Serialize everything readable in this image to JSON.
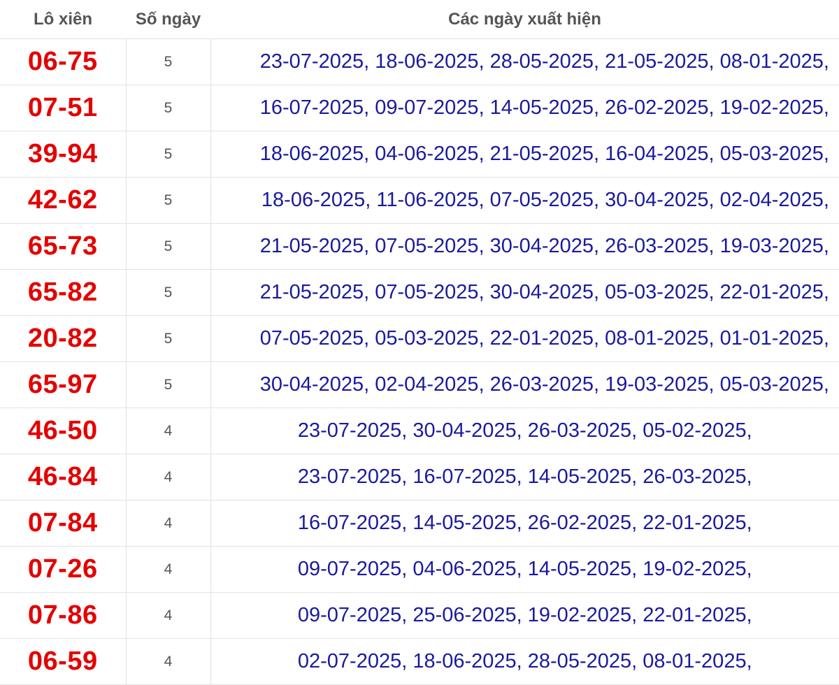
{
  "table": {
    "headers": {
      "pair": "Lô xiên",
      "count": "Số ngày",
      "dates": "Các ngày xuất hiện"
    },
    "rows": [
      {
        "pair": "06-75",
        "count": "5",
        "dates": "23-07-2025, 18-06-2025, 28-05-2025, 21-05-2025, 08-01-2025,"
      },
      {
        "pair": "07-51",
        "count": "5",
        "dates": "16-07-2025, 09-07-2025, 14-05-2025, 26-02-2025, 19-02-2025,"
      },
      {
        "pair": "39-94",
        "count": "5",
        "dates": "18-06-2025, 04-06-2025, 21-05-2025, 16-04-2025, 05-03-2025,"
      },
      {
        "pair": "42-62",
        "count": "5",
        "dates": "18-06-2025, 11-06-2025, 07-05-2025, 30-04-2025, 02-04-2025,"
      },
      {
        "pair": "65-73",
        "count": "5",
        "dates": "21-05-2025, 07-05-2025, 30-04-2025, 26-03-2025, 19-03-2025,"
      },
      {
        "pair": "65-82",
        "count": "5",
        "dates": "21-05-2025, 07-05-2025, 30-04-2025, 05-03-2025, 22-01-2025,"
      },
      {
        "pair": "20-82",
        "count": "5",
        "dates": "07-05-2025, 05-03-2025, 22-01-2025, 08-01-2025, 01-01-2025,"
      },
      {
        "pair": "65-97",
        "count": "5",
        "dates": "30-04-2025, 02-04-2025, 26-03-2025, 19-03-2025, 05-03-2025,"
      },
      {
        "pair": "46-50",
        "count": "4",
        "dates": "23-07-2025, 30-04-2025, 26-03-2025, 05-02-2025,"
      },
      {
        "pair": "46-84",
        "count": "4",
        "dates": "23-07-2025, 16-07-2025, 14-05-2025, 26-03-2025,"
      },
      {
        "pair": "07-84",
        "count": "4",
        "dates": "16-07-2025, 14-05-2025, 26-02-2025, 22-01-2025,"
      },
      {
        "pair": "07-26",
        "count": "4",
        "dates": "09-07-2025, 04-06-2025, 14-05-2025, 19-02-2025,"
      },
      {
        "pair": "07-86",
        "count": "4",
        "dates": "09-07-2025, 25-06-2025, 19-02-2025, 22-01-2025,"
      },
      {
        "pair": "06-59",
        "count": "4",
        "dates": "02-07-2025, 18-06-2025, 28-05-2025, 08-01-2025,"
      }
    ]
  },
  "colors": {
    "pair_text": "#e50000",
    "dates_text": "#1a1a9c",
    "header_text": "#555555",
    "border": "#e2e2e2"
  }
}
